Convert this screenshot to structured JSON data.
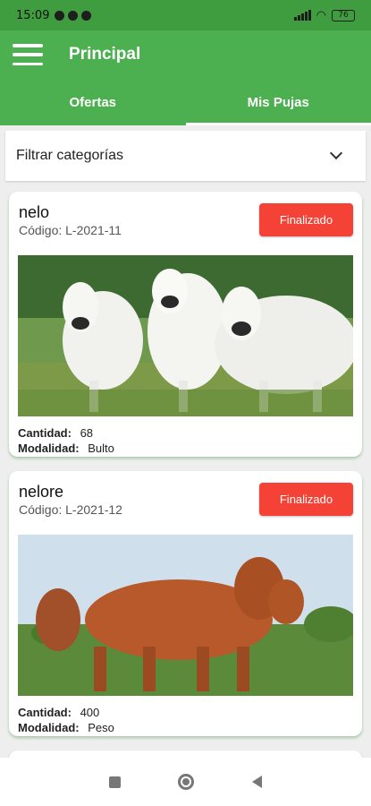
{
  "status_bar": {
    "time": "15:09",
    "battery": "76"
  },
  "app_bar": {
    "title": "Principal"
  },
  "tabs": [
    {
      "label": "Ofertas",
      "active": false
    },
    {
      "label": "Mis Pujas",
      "active": true
    }
  ],
  "filter": {
    "label": "Filtrar categorías"
  },
  "lots": [
    {
      "name": "nelo",
      "code": "Código: L-2021-11",
      "status": "Finalizado",
      "quantity_label": "Cantidad:",
      "quantity": "68",
      "mode_label": "Modalidad:",
      "mode": "Bulto"
    },
    {
      "name": "nelore",
      "code": "Código: L-2021-12",
      "status": "Finalizado",
      "quantity_label": "Cantidad:",
      "quantity": "400",
      "mode_label": "Modalidad:",
      "mode": "Peso"
    }
  ],
  "colors": {
    "primary": "#4caf50",
    "status_bar": "#3f9c3f",
    "badge": "#f44336"
  },
  "icons": {
    "menu": "hamburger-icon",
    "filter": "chevron-down-icon",
    "nav": [
      "square-icon",
      "circle-icon",
      "back-triangle-icon"
    ]
  }
}
